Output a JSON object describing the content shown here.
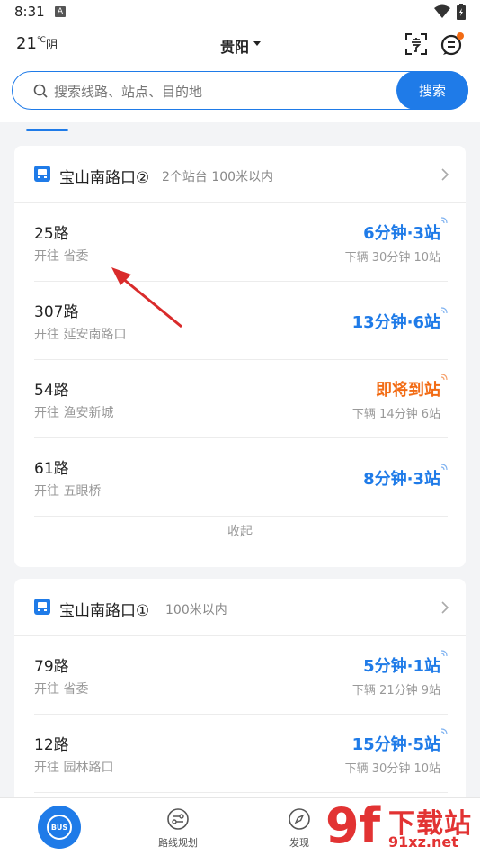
{
  "status": {
    "time": "8:31",
    "badge": "A"
  },
  "header": {
    "temperature": "21",
    "temp_unit": "℃",
    "weather": "阴",
    "city": "贵阳"
  },
  "search": {
    "placeholder": "搜索线路、站点、目的地",
    "button": "搜索"
  },
  "stops": [
    {
      "name": "宝山南路口②",
      "sub": "2个站台 100米以内",
      "routes": [
        {
          "num": "25路",
          "dir": "开往 省委",
          "eta": "6分钟·3站",
          "next": "下辆  30分钟 10站"
        },
        {
          "num": "307路",
          "dir": "开往 延安南路口",
          "eta": "13分钟·6站",
          "next": ""
        },
        {
          "num": "54路",
          "dir": "开往 渔安新城",
          "eta": "即将到站",
          "next": "下辆  14分钟 6站"
        },
        {
          "num": "61路",
          "dir": "开往 五眼桥",
          "eta": "8分钟·3站",
          "next": ""
        }
      ],
      "collapse": "收起"
    },
    {
      "name": "宝山南路口①",
      "sub": "100米以内",
      "routes": [
        {
          "num": "79路",
          "dir": "开往 省委",
          "eta": "5分钟·1站",
          "next": "下辆  21分钟 9站"
        },
        {
          "num": "12路",
          "dir": "开往 园林路口",
          "eta": "15分钟·5站",
          "next": "下辆  30分钟 10站"
        }
      ]
    }
  ],
  "nav": {
    "home_badge": "BUS",
    "route_plan": "路线规划",
    "discover": "发现"
  },
  "colors": {
    "accent": "#1f7be8",
    "arriving": "#f26b14"
  },
  "watermark": {
    "big": "9f",
    "title": "下载站",
    "url": "91xz.net"
  }
}
